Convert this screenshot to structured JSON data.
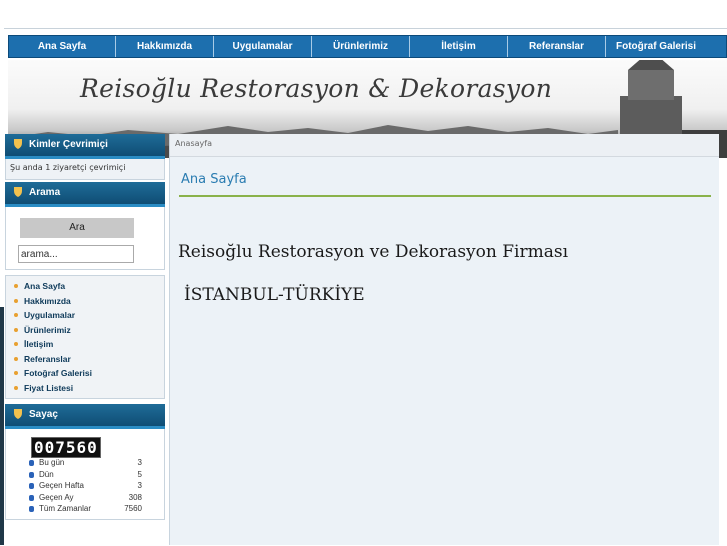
{
  "nav": [
    "Ana Sayfa",
    "Hakkımızda",
    "Uygulamalar",
    "Ürünlerimiz",
    "İletişim",
    "Referanslar",
    "Fotoğraf Galerisi"
  ],
  "banner_title": "Reisoğlu Restorasyon & Dekorasyon",
  "online": {
    "title": "Kimler Çevrimiçi",
    "text": "Şu anda 1 ziyaretçi çevrimiçi"
  },
  "search": {
    "title": "Arama",
    "button": "Ara",
    "value": "arama..."
  },
  "menu": [
    "Ana Sayfa",
    "Hakkımızda",
    "Uygulamalar",
    "Ürünlerimiz",
    "İletişim",
    "Referanslar",
    "Fotoğraf Galerisi",
    "Fiyat Listesi"
  ],
  "counter": {
    "title": "Sayaç",
    "display": "007560",
    "rows": [
      {
        "label": "Bu gün",
        "value": "3"
      },
      {
        "label": "Dün",
        "value": "5"
      },
      {
        "label": "Geçen Hafta",
        "value": "3"
      },
      {
        "label": "Geçen Ay",
        "value": "308"
      },
      {
        "label": "Tüm Zamanlar",
        "value": "7560"
      }
    ]
  },
  "content": {
    "breadcrumb": "Anasayfa",
    "title": "Ana Sayfa",
    "heading": "Reisoğlu Restorasyon ve Dekorasyon Firması",
    "subheading": "İSTANBUL-TÜRKİYE"
  },
  "colors": {
    "nav": "#1d6fae",
    "box_header": "#0f4d74",
    "title_accent": "#2a7cb1",
    "rule": "#8ab24a"
  }
}
